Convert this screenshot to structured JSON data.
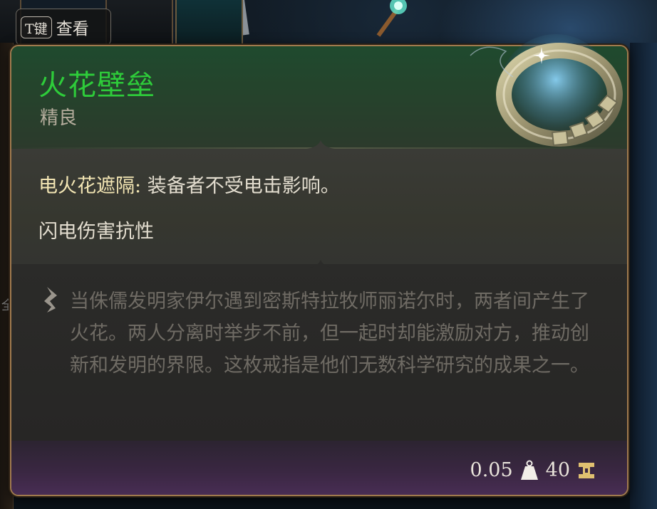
{
  "peek": {
    "key": "T键",
    "label": "查看"
  },
  "item": {
    "name": "火花壁垒",
    "rarity": "精良",
    "name_color": "#2ecc3a",
    "icon": "ring-icon"
  },
  "properties": [
    {
      "name": "电火花遮隔:",
      "text": " 装备者不受电击影响。"
    },
    {
      "name": "",
      "text": "闪电伤害抗性"
    }
  ],
  "description": "当侏儒发明家伊尔遇到密斯特拉牧师丽诺尔时，两者间产生了火花。两人分离时举步不前，但一起时却能激励对方，推动创新和发明的界限。这枚戒指是他们无数科学研究的成果之一。",
  "footer": {
    "weight": "0.05",
    "weight_icon": "weight-icon",
    "value": "40",
    "value_icon": "gold-coin-icon"
  },
  "side_mark": "全"
}
